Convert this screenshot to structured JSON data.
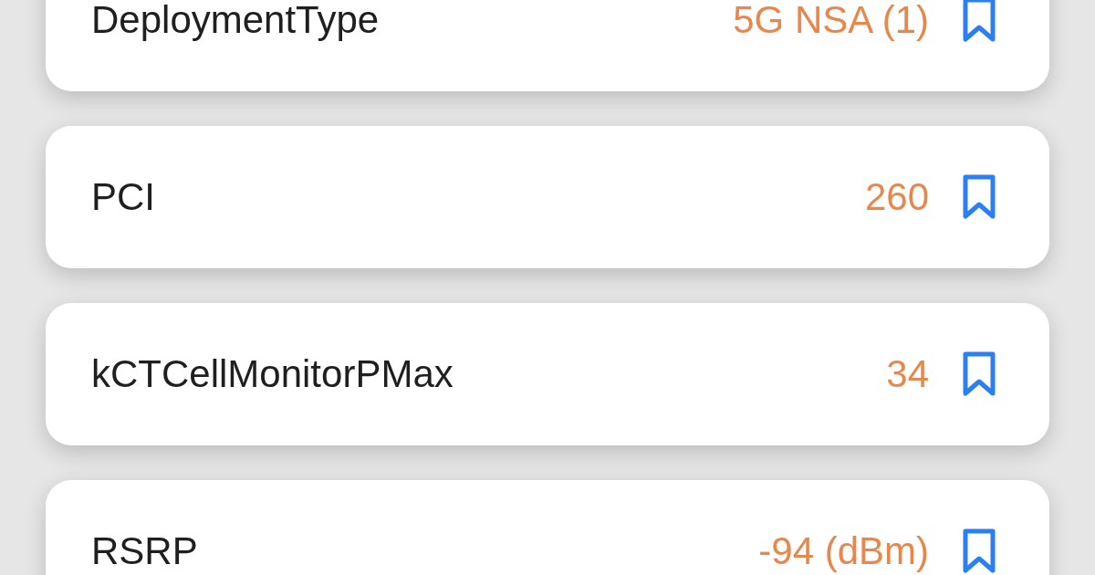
{
  "rows": [
    {
      "label": "DeploymentType",
      "value": "5G NSA (1)"
    },
    {
      "label": "PCI",
      "value": "260"
    },
    {
      "label": "kCTCellMonitorPMax",
      "value": "34"
    },
    {
      "label": "RSRP",
      "value": "-94 (dBm)"
    }
  ]
}
